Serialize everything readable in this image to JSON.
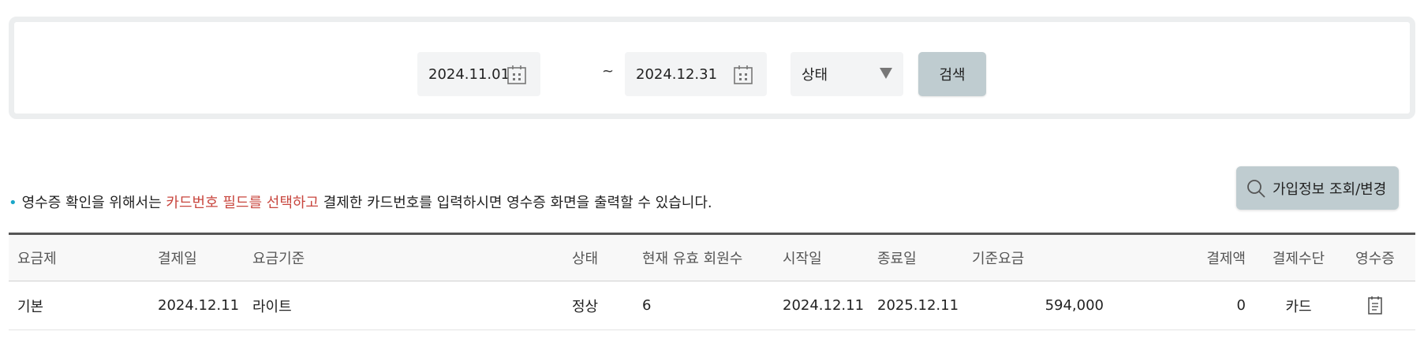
{
  "filters": {
    "start_date": "2024.11.01",
    "separator": "~",
    "end_date": "2024.12.31",
    "status_select": "상태",
    "search_button": "검색"
  },
  "notice": {
    "bullet": "•",
    "before": "영수증 확인을 위해서는 ",
    "highlight": "카드번호 필드를 선택하고",
    "after": " 결제한 카드번호를 입력하시면 영수증 화면을 출력할 수 있습니다."
  },
  "join_button": "가입정보 조회/변경",
  "table": {
    "headers": [
      "요금제",
      "결제일",
      "요금기준",
      "상태",
      "현재 유효 회원수",
      "시작일",
      "종료일",
      "기준요금",
      "결제액",
      "결제수단",
      "영수증"
    ],
    "rows": [
      [
        "기본",
        "2024.12.11",
        "라이트",
        "정상",
        "6",
        "2024.12.11",
        "2025.12.11",
        "594,000",
        "0",
        "카드",
        ""
      ]
    ]
  },
  "colors": {
    "accent_highlight": "#c8463e",
    "bullet": "#1aa6c8",
    "button_bg": "#bfccd0"
  },
  "icons": {
    "date": "calendar-icon",
    "select": "caret-down-icon",
    "join": "search-icon",
    "receipt": "receipt-icon"
  }
}
